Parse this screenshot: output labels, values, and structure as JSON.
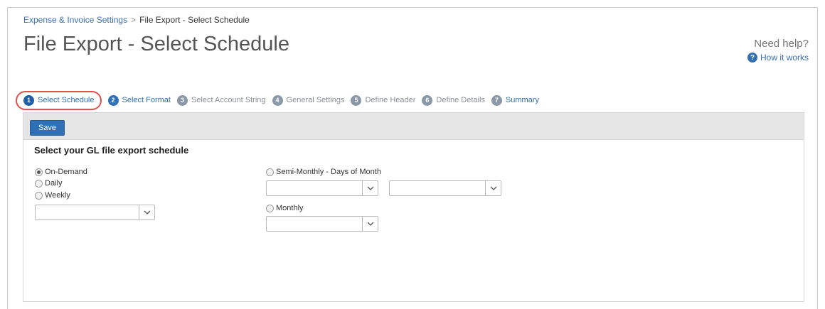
{
  "breadcrumb": {
    "parent": "Expense & Invoice Settings",
    "separator": ">",
    "current": "File Export - Select Schedule"
  },
  "page_title": "File Export - Select Schedule",
  "help": {
    "need_help": "Need help?",
    "how_it_works": "How it works",
    "icon": "question-circle-icon"
  },
  "steps": [
    {
      "num": "1",
      "label": "Select Schedule",
      "state": "current"
    },
    {
      "num": "2",
      "label": "Select Format",
      "state": "done"
    },
    {
      "num": "3",
      "label": "Select Account String",
      "state": "todo"
    },
    {
      "num": "4",
      "label": "General Settings",
      "state": "todo"
    },
    {
      "num": "5",
      "label": "Define Header",
      "state": "todo"
    },
    {
      "num": "6",
      "label": "Define Details",
      "state": "todo"
    },
    {
      "num": "7",
      "label": "Summary",
      "state": "done"
    }
  ],
  "toolbar": {
    "save_label": "Save"
  },
  "section_title": "Select your GL file export schedule",
  "schedule_options": {
    "on_demand": "On-Demand",
    "daily": "Daily",
    "weekly": "Weekly",
    "semi_monthly": "Semi-Monthly - Days of Month",
    "monthly": "Monthly",
    "selected": "On-Demand"
  },
  "dropdowns": {
    "weekly_value": "",
    "semi_monthly_first_value": "",
    "semi_monthly_second_value": "",
    "monthly_value": ""
  },
  "colors": {
    "accent": "#2e6fb5",
    "highlight_ring": "#e0514c",
    "toolbar_bg": "#e6e6e6"
  }
}
